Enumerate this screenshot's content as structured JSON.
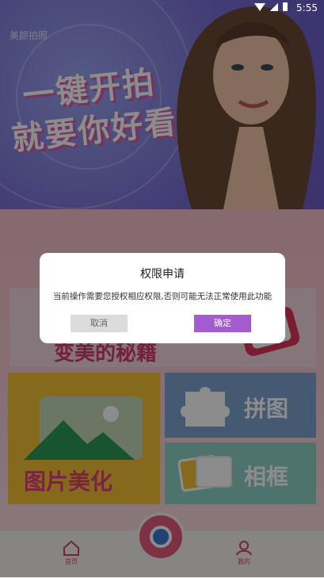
{
  "status_bar": {
    "time": "5:55"
  },
  "banner": {
    "app_name": "美颜拍照",
    "slogan_line1": "一键开拍",
    "slogan_line2": "就要你好看"
  },
  "cards": {
    "wide_label": "变美的秘籍",
    "beautify_label": "图片美化",
    "collage_label": "拼图",
    "frame_label": "相框"
  },
  "dialog": {
    "title": "权限申请",
    "message": "当前操作需要您授权相应权限,否则可能无法正常使用此功能",
    "cancel_label": "取消",
    "confirm_label": "确定"
  },
  "bottom_nav": {
    "home_label": "首页",
    "mine_label": "我的"
  }
}
